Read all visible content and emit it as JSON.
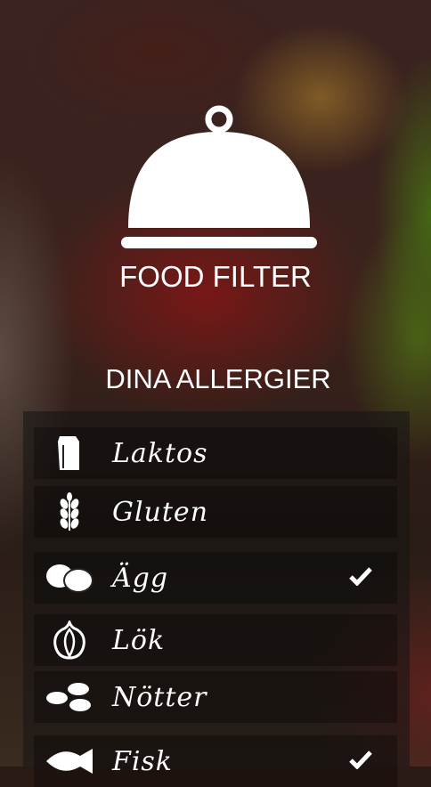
{
  "app": {
    "title": "FOOD FILTER"
  },
  "section": {
    "title": "DINA ALLERGIER"
  },
  "allergies": [
    {
      "label": "Laktos",
      "icon": "milk-carton-icon",
      "checked": false
    },
    {
      "label": "Gluten",
      "icon": "wheat-icon",
      "checked": false
    },
    {
      "label": "Ägg",
      "icon": "eggs-icon",
      "checked": true
    },
    {
      "label": "Lök",
      "icon": "onion-icon",
      "checked": false
    },
    {
      "label": "Nötter",
      "icon": "nuts-icon",
      "checked": false
    },
    {
      "label": "Fisk",
      "icon": "fish-icon",
      "checked": true
    }
  ]
}
